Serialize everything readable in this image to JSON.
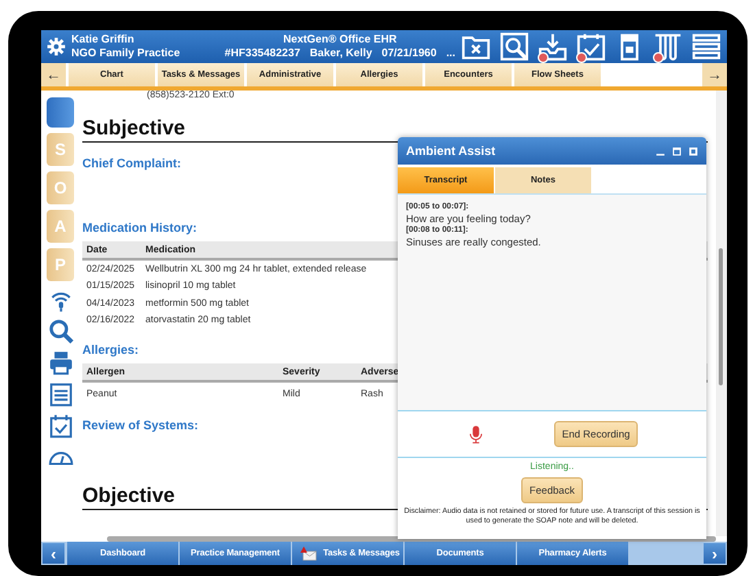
{
  "header": {
    "user": "Katie Griffin",
    "practice": "NGO Family Practice",
    "app_title": "NextGen® Office EHR",
    "patient_id": "#HF335482237",
    "patient_name": "Baker, Kelly",
    "dob": "07/21/1960",
    "more": "...",
    "toolbar": [
      {
        "alert": false
      },
      {
        "alert": false
      },
      {
        "alert": true
      },
      {
        "alert": true
      },
      {
        "alert": false
      },
      {
        "alert": true
      },
      {
        "alert": false
      }
    ]
  },
  "tabs": {
    "back": "←",
    "items": [
      "Chart",
      "Tasks & Messages",
      "Administrative",
      "Allergies",
      "Encounters",
      "Flow Sheets"
    ],
    "forward": "→"
  },
  "soap_tabs": [
    "S",
    "O",
    "A",
    "P"
  ],
  "note": {
    "phone": "(858)523-2120 Ext:0",
    "subjective": {
      "title": "Subjective",
      "chief_complaint": "Chief Complaint:",
      "medication_history": {
        "title": "Medication History:",
        "columns": [
          "Date",
          "Medication"
        ],
        "rows": [
          [
            "02/24/2025",
            "Wellbutrin XL 300 mg 24 hr tablet, extended release"
          ],
          [
            "01/15/2025",
            "lisinopril 10 mg tablet"
          ],
          [
            "04/14/2023",
            "metformin 500 mg tablet"
          ],
          [
            "02/16/2022",
            "atorvastatin 20 mg tablet"
          ]
        ]
      },
      "allergies": {
        "title": "Allergies:",
        "columns": [
          "Allergen",
          "Severity",
          "Adverse"
        ],
        "rows": [
          [
            "Peanut",
            "Mild",
            "Rash"
          ]
        ]
      },
      "review_of_systems": "Review of Systems:"
    },
    "objective": {
      "title": "Objective"
    }
  },
  "popup": {
    "title": "Ambient Assist",
    "tabs": [
      {
        "label": "Transcript",
        "selected": true
      },
      {
        "label": "Notes",
        "selected": false
      }
    ],
    "transcript": [
      {
        "time": "[00:05 to 00:07]:",
        "text": "How are you feeling today?"
      },
      {
        "time": "[00:08 to 00:11]:",
        "text": "Sinuses are really congested."
      }
    ],
    "end_recording": "End Recording",
    "status": "Listening..",
    "feedback": "Feedback",
    "disclaimer": "Disclaimer: Audio data is not retained or stored for future use. A transcript of this session is used to generate the SOAP note and will be deleted."
  },
  "bottom_bar": {
    "back": "‹",
    "items": [
      {
        "label": "Dashboard",
        "alert": false
      },
      {
        "label": "Practice Management",
        "alert": false
      },
      {
        "label": "Tasks & Messages",
        "alert": true
      },
      {
        "label": "Documents",
        "alert": false
      },
      {
        "label": "Pharmacy Alerts",
        "alert": false
      }
    ],
    "forward": "›"
  }
}
